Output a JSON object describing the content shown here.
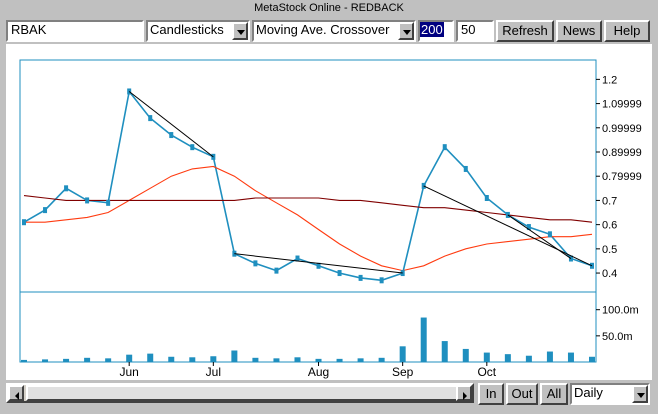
{
  "window": {
    "title": "MetaStock Online - REDBACK"
  },
  "toolbar": {
    "symbol": "RBAK",
    "chart_style": "Candlesticks",
    "indicator": "Moving Ave. Crossover",
    "ma_fast": "200",
    "ma_slow": "50",
    "refresh_label": "Refresh",
    "news_label": "News",
    "help_label": "Help"
  },
  "chart": {
    "price_ticks": [
      "1.2",
      "1.09999",
      "0.99999",
      "0.89999",
      "0.79999",
      "0.7",
      "0.6",
      "0.5",
      "0.4"
    ],
    "volume_ticks": [
      "100.0m",
      "50.0m"
    ],
    "month_labels": [
      "Jun",
      "Jul",
      "Aug",
      "Sep",
      "Oct"
    ],
    "colors": {
      "price": "#1f8fbf",
      "ma_short": "#ff3b10",
      "ma_long": "#800000",
      "trendline": "#000000",
      "frame": "#1f8fbf"
    }
  },
  "chart_data": {
    "type": "line",
    "title": "",
    "xlabel": "",
    "ylabel": "",
    "ylim": [
      0.33,
      1.28
    ],
    "x": [
      "May 1",
      "May 8",
      "May 15",
      "May 22",
      "May 29",
      "Jun 5",
      "Jun 12",
      "Jun 19",
      "Jun 26",
      "Jul 3",
      "Jul 10",
      "Jul 17",
      "Jul 24",
      "Jul 31",
      "Aug 7",
      "Aug 14",
      "Aug 21",
      "Aug 28",
      "Sep 4",
      "Sep 11",
      "Sep 18",
      "Sep 25",
      "Oct 2",
      "Oct 9",
      "Oct 16",
      "Oct 23",
      "Oct 30",
      "Nov 3"
    ],
    "series": [
      {
        "values": [
          0.61,
          0.66,
          0.75,
          0.7,
          0.69,
          1.15,
          1.04,
          0.97,
          0.92,
          0.88,
          0.48,
          0.44,
          0.41,
          0.46,
          0.43,
          0.4,
          0.38,
          0.37,
          0.4,
          0.76,
          0.92,
          0.83,
          0.71,
          0.64,
          0.59,
          0.56,
          0.46,
          0.43
        ]
      },
      {
        "values": [
          0.61,
          0.61,
          0.62,
          0.63,
          0.65,
          0.7,
          0.75,
          0.8,
          0.83,
          0.84,
          0.8,
          0.74,
          0.69,
          0.64,
          0.58,
          0.52,
          0.47,
          0.43,
          0.41,
          0.43,
          0.47,
          0.5,
          0.52,
          0.53,
          0.54,
          0.55,
          0.55,
          0.56
        ]
      },
      {
        "values": [
          0.72,
          0.71,
          0.7,
          0.7,
          0.7,
          0.7,
          0.7,
          0.7,
          0.7,
          0.7,
          0.7,
          0.71,
          0.71,
          0.71,
          0.71,
          0.7,
          0.7,
          0.69,
          0.68,
          0.67,
          0.67,
          0.66,
          0.65,
          0.64,
          0.63,
          0.62,
          0.62,
          0.61
        ]
      }
    ],
    "volume_ylim": [
      0,
      130
    ],
    "volume_values": [
      4,
      5,
      6,
      8,
      7,
      14,
      16,
      10,
      9,
      11,
      22,
      8,
      7,
      9,
      6,
      6,
      7,
      8,
      30,
      85,
      40,
      25,
      18,
      15,
      12,
      20,
      18,
      10
    ]
  },
  "bottom": {
    "in_label": "In",
    "out_label": "Out",
    "all_label": "All",
    "period": "Daily"
  }
}
